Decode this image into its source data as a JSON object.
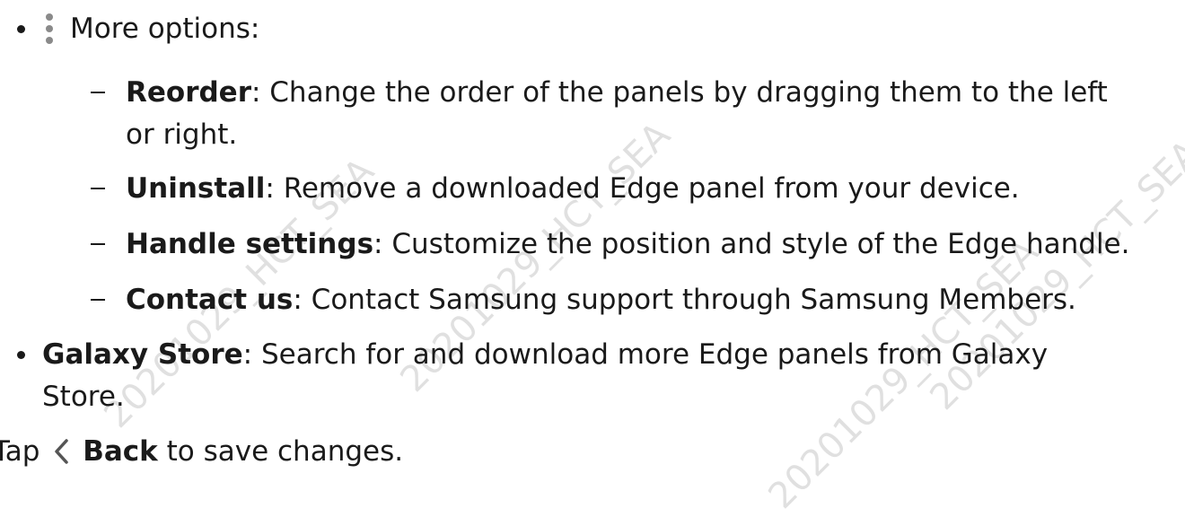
{
  "list": {
    "more_options": {
      "icon": "more-options-icon",
      "label": "More options",
      "colon": ":"
    },
    "sub_items": [
      {
        "term": "Reorder",
        "desc_line1": ": Change the order of the panels by dragging them to the left",
        "desc_line2": "or right."
      },
      {
        "term": "Uninstall",
        "desc_line1": ": Remove a downloaded Edge panel from your device."
      },
      {
        "term": "Handle settings",
        "desc_line1": ": Customize the position and style of the Edge handle."
      },
      {
        "term": "Contact us",
        "desc_line1": ": Contact Samsung support through Samsung Members."
      }
    ],
    "galaxy_store": {
      "term": "Galaxy Store",
      "desc_line1": ": Search for and download more Edge panels from Galaxy",
      "desc_line2": "Store."
    }
  },
  "step": {
    "prefix": "Tap",
    "icon": "back-chevron-icon",
    "term": "Back",
    "suffix": "to save changes."
  },
  "watermark": {
    "text": "20201029_HCT_SEA"
  }
}
